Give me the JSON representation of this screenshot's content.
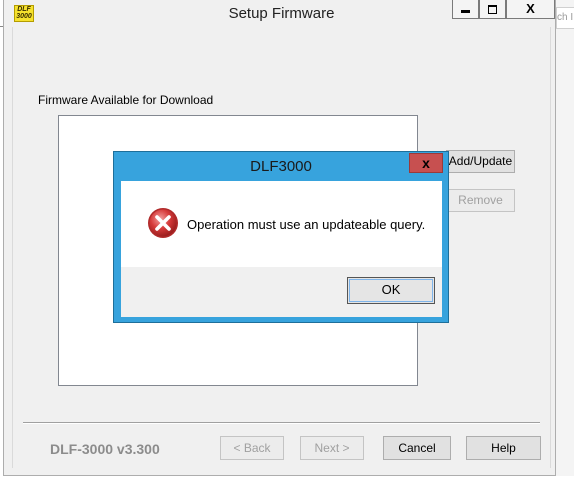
{
  "background": {
    "right_edge_text": "ch I"
  },
  "window": {
    "title": "Setup Firmware",
    "app_icon_text": "DLF 3000",
    "firmware_label": "Firmware Available for Download",
    "add_update_label": "Add/Update",
    "remove_label": "Remove",
    "version": "DLF-3000 v3.300",
    "back_label": "< Back",
    "next_label": "Next >",
    "cancel_label": "Cancel",
    "help_label": "Help",
    "close_glyph": "X"
  },
  "dialog": {
    "title": "DLF3000",
    "close_glyph": "x",
    "message": "Operation must use an updateable query.",
    "ok_label": "OK"
  },
  "colors": {
    "dialog_frame": "#37a3dd",
    "dialog_close": "#c75050",
    "error_icon": "#d63a3a"
  },
  "icons": {
    "app": "dlf-app-icon",
    "error": "error-circle-x-icon"
  }
}
